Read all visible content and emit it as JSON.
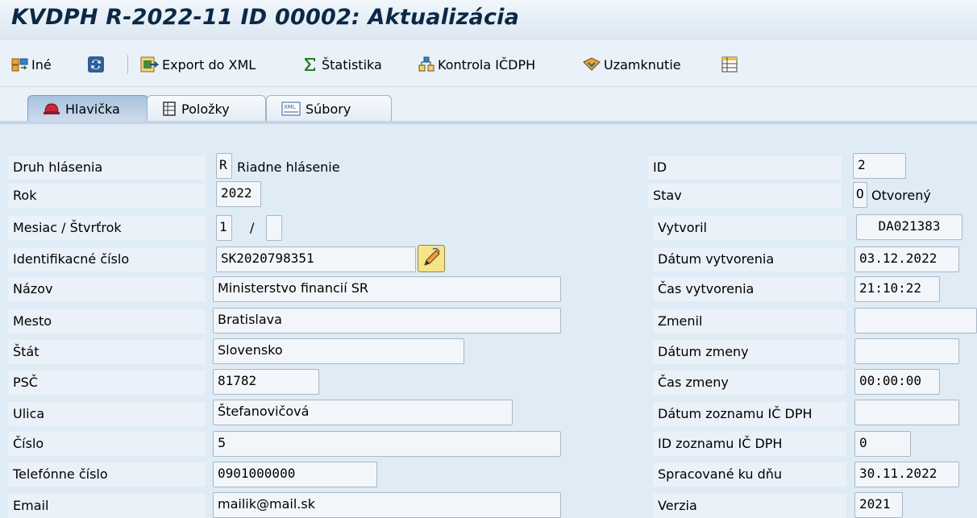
{
  "window": {
    "title": "KVDPH R-2022-11 ID 00002: Aktualizácia"
  },
  "toolbar": {
    "ine_label": "Iné",
    "export_label": "Export do XML",
    "statistika_label": "Štatistika",
    "kontrola_label": "Kontrola IČDPH",
    "uzamknutie_label": "Uzamknutie"
  },
  "tabs": [
    {
      "label": "Hlavička",
      "active": true
    },
    {
      "label": "Položky",
      "active": false
    },
    {
      "label": "Súbory",
      "active": false
    }
  ],
  "left": {
    "druh_label": "Druh hlásenia",
    "druh_code": "R",
    "druh_text": "Riadne hlásenie",
    "rok_label": "Rok",
    "rok_value": "2022",
    "mesiac_label": "Mesiac / Štvrťrok",
    "mesiac_value": "1",
    "mesiac_sep": "/",
    "stvrtrok_value": "",
    "ic_label": "Identifikacné číslo",
    "ic_value": "SK2020798351",
    "nazov_label": "Názov",
    "nazov_value": "Ministerstvo financií SR",
    "mesto_label": "Mesto",
    "mesto_value": "Bratislava",
    "stat_label": "Štát",
    "stat_value": "Slovensko",
    "psc_label": "PSČ",
    "psc_value": "81782",
    "ulica_label": "Ulica",
    "ulica_value": "Štefanovičová",
    "cislo_label": "Číslo",
    "cislo_value": "5",
    "tel_label": "Telefónne číslo",
    "tel_value": "0901000000",
    "email_label": "Email",
    "email_value": "mailik@mail.sk"
  },
  "right": {
    "id_label": "ID",
    "id_value": "2",
    "stav_label": "Stav",
    "stav_code": "O",
    "stav_text": "Otvorený",
    "vytvoril_label": "Vytvoril",
    "vytvoril_value": "DA021383",
    "datum_vytv_label": "Dátum vytvorenia",
    "datum_vytv_value": "03.12.2022",
    "cas_vytv_label": "Čas vytvorenia",
    "cas_vytv_value": "21:10:22",
    "zmenil_label": "Zmenil",
    "zmenil_value": "",
    "datum_zmeny_label": "Dátum zmeny",
    "datum_zmeny_value": "",
    "cas_zmeny_label": "Čas zmeny",
    "cas_zmeny_value": "00:00:00",
    "datum_zoznamu_label": "Dátum zoznamu IČ DPH",
    "datum_zoznamu_value": "",
    "id_zoznamu_label": "ID zoznamu IČ DPH",
    "id_zoznamu_value": "0",
    "spracovane_label": "Spracované ku dňu",
    "spracovane_value": "30.11.2022",
    "verzia_label": "Verzia",
    "verzia_value": "2021"
  },
  "colors": {
    "title": "#0b2946",
    "background": "#dfebf5",
    "field_border": "#a9b7c4"
  }
}
